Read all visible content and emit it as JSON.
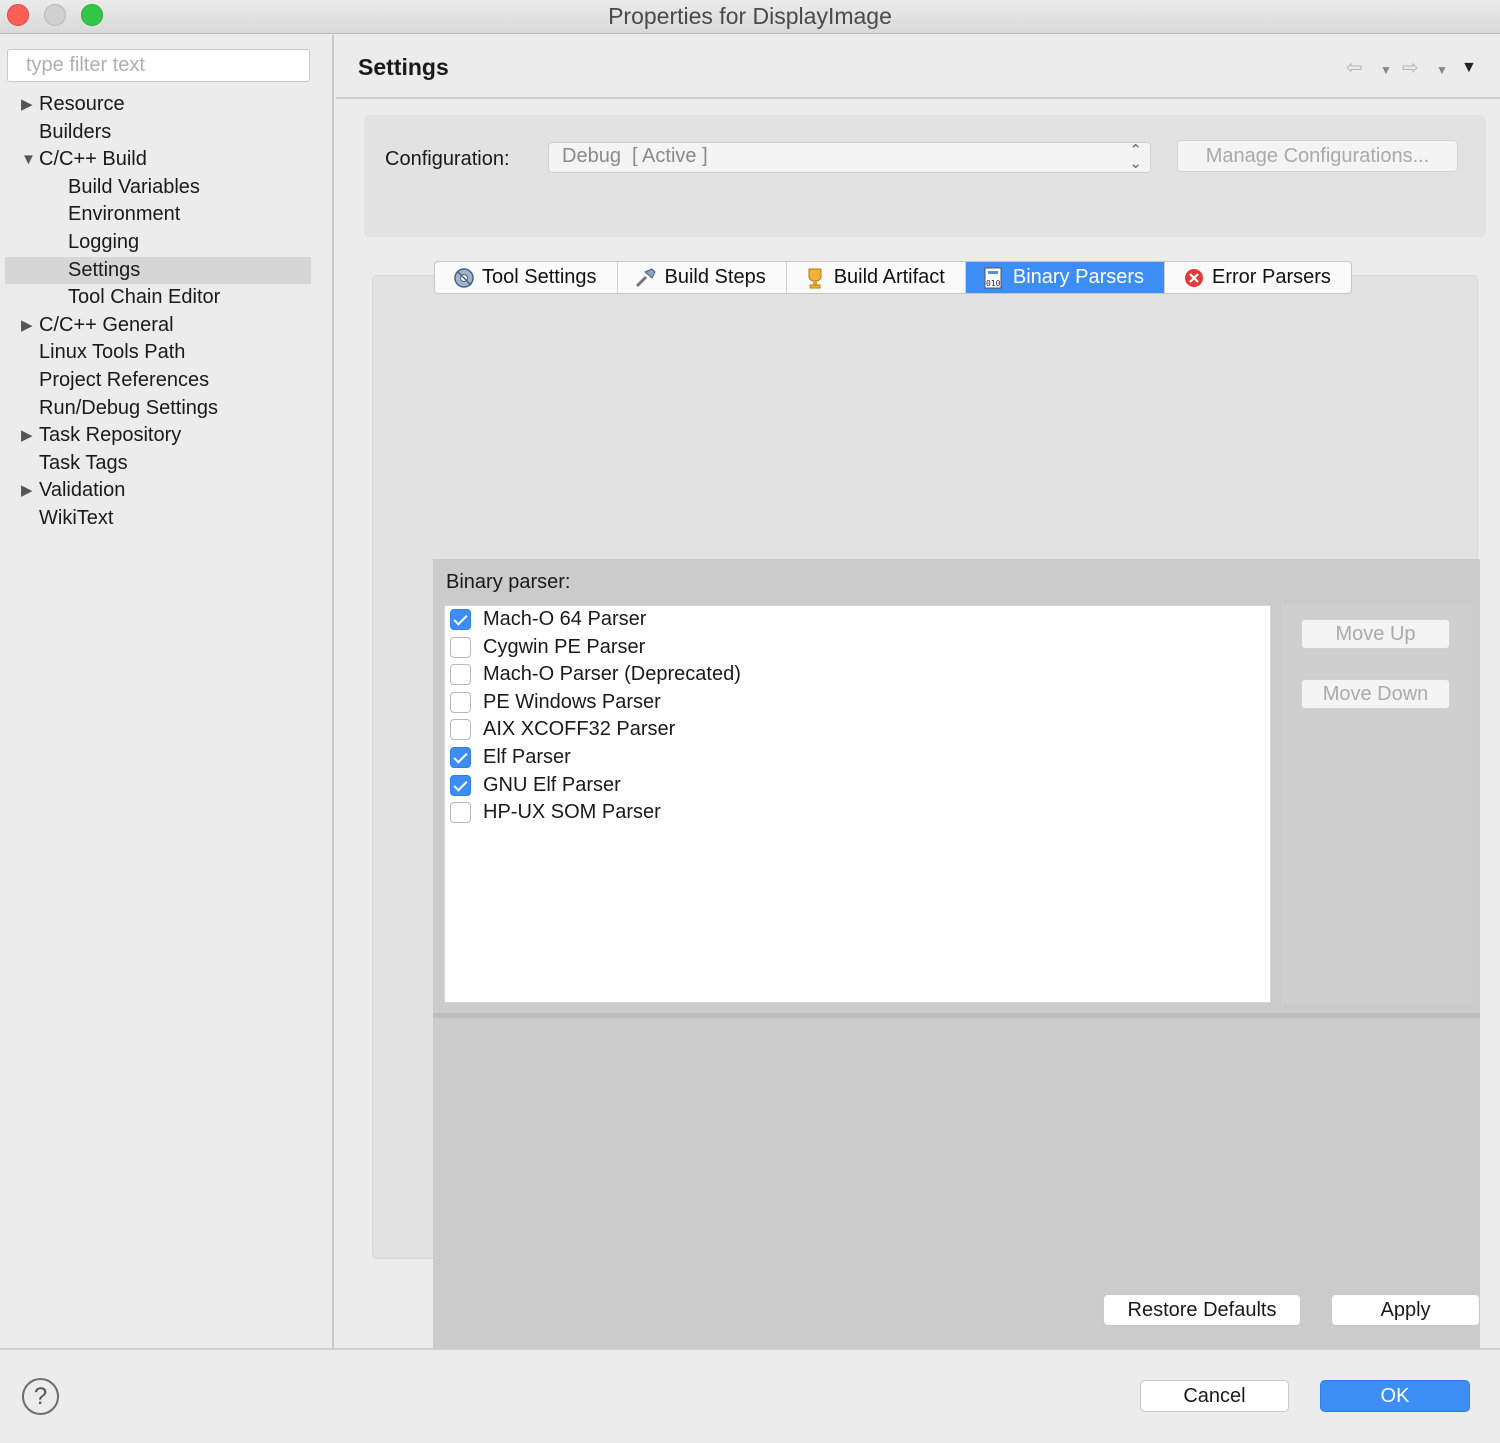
{
  "window": {
    "title": "Properties for DisplayImage"
  },
  "left": {
    "filter_placeholder": "type filter text",
    "tree": [
      {
        "label": "Resource",
        "level": 1,
        "twisty": "collapsed"
      },
      {
        "label": "Builders",
        "level": 1,
        "twisty": "none"
      },
      {
        "label": "C/C++ Build",
        "level": 1,
        "twisty": "expanded"
      },
      {
        "label": "Build Variables",
        "level": 2,
        "twisty": "none"
      },
      {
        "label": "Environment",
        "level": 2,
        "twisty": "none"
      },
      {
        "label": "Logging",
        "level": 2,
        "twisty": "none"
      },
      {
        "label": "Settings",
        "level": 2,
        "twisty": "none",
        "selected": true
      },
      {
        "label": "Tool Chain Editor",
        "level": 2,
        "twisty": "none"
      },
      {
        "label": "C/C++ General",
        "level": 1,
        "twisty": "collapsed"
      },
      {
        "label": "Linux Tools Path",
        "level": 1,
        "twisty": "none"
      },
      {
        "label": "Project References",
        "level": 1,
        "twisty": "none"
      },
      {
        "label": "Run/Debug Settings",
        "level": 1,
        "twisty": "none"
      },
      {
        "label": "Task Repository",
        "level": 1,
        "twisty": "collapsed"
      },
      {
        "label": "Task Tags",
        "level": 1,
        "twisty": "none"
      },
      {
        "label": "Validation",
        "level": 1,
        "twisty": "collapsed"
      },
      {
        "label": "WikiText",
        "level": 1,
        "twisty": "none"
      }
    ]
  },
  "header": {
    "title": "Settings",
    "back_icon": "back-arrow-icon",
    "forward_icon": "forward-arrow-icon",
    "menu_icon": "view-menu-icon"
  },
  "config": {
    "label": "Configuration:",
    "selected": "Debug  [ Active ]",
    "manage_label": "Manage Configurations..."
  },
  "tabs": [
    {
      "label": "Tool Settings",
      "icon": "tool-settings-icon"
    },
    {
      "label": "Build Steps",
      "icon": "build-steps-icon"
    },
    {
      "label": "Build Artifact",
      "icon": "build-artifact-icon"
    },
    {
      "label": "Binary Parsers",
      "icon": "binary-parsers-icon",
      "active": true
    },
    {
      "label": "Error Parsers",
      "icon": "error-parsers-icon"
    }
  ],
  "binary": {
    "label": "Binary parser:",
    "parsers": [
      {
        "label": "Mach-O 64 Parser",
        "checked": true
      },
      {
        "label": "Cygwin PE Parser",
        "checked": false
      },
      {
        "label": "Mach-O Parser (Deprecated)",
        "checked": false
      },
      {
        "label": "PE Windows Parser",
        "checked": false
      },
      {
        "label": "AIX XCOFF32 Parser",
        "checked": false
      },
      {
        "label": "Elf Parser",
        "checked": true
      },
      {
        "label": "GNU Elf Parser",
        "checked": true
      },
      {
        "label": "HP-UX SOM Parser",
        "checked": false
      }
    ],
    "move_up": "Move Up",
    "move_down": "Move Down"
  },
  "buttons": {
    "restore": "Restore Defaults",
    "apply": "Apply",
    "cancel": "Cancel",
    "ok": "OK",
    "help_icon": "help-icon"
  },
  "colors": {
    "accent": "#3c8df4"
  }
}
